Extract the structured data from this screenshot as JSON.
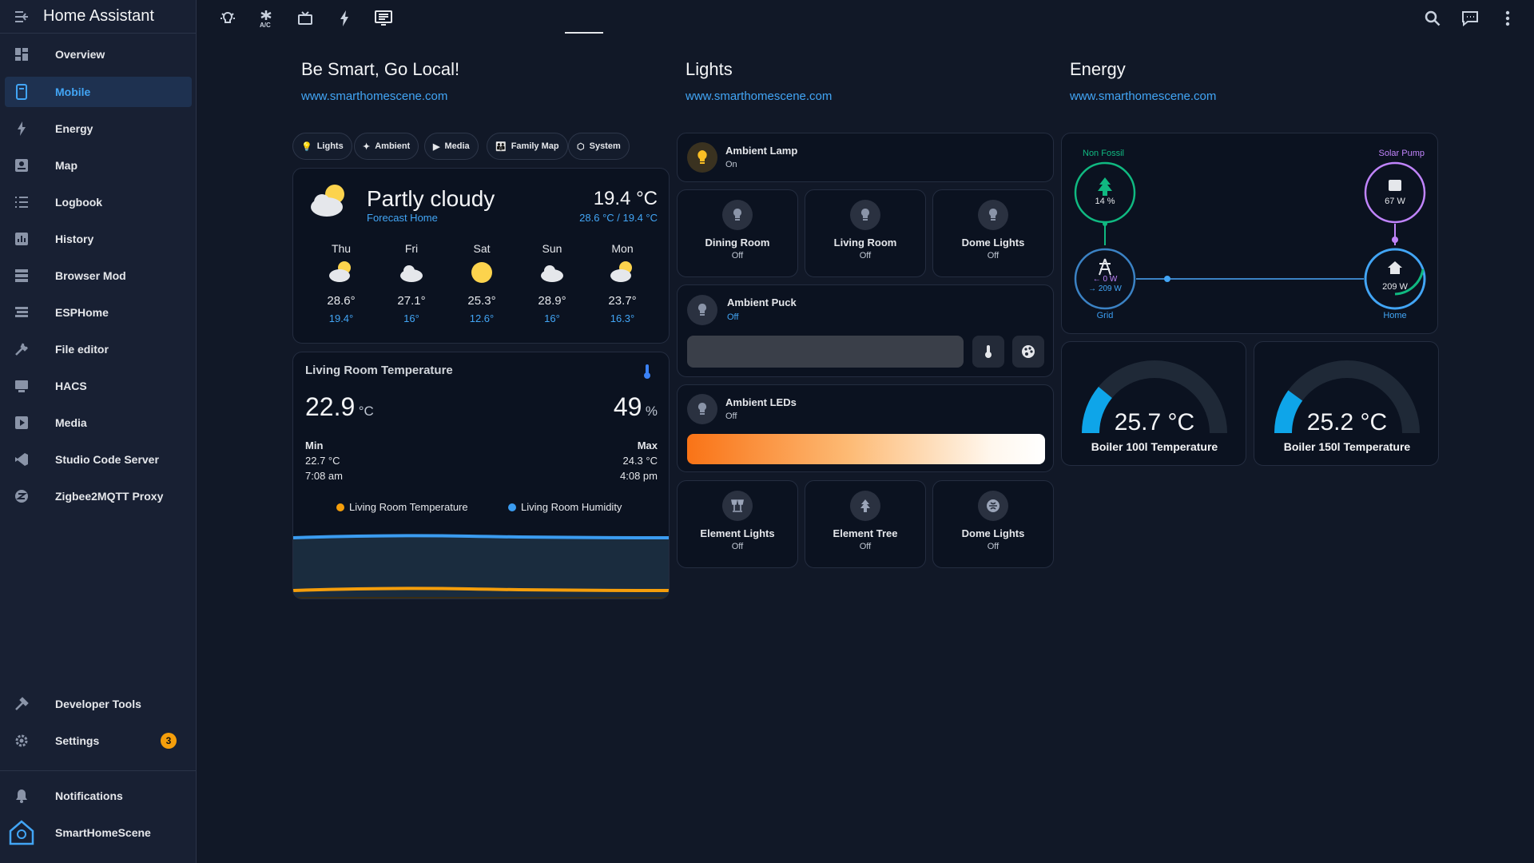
{
  "app": {
    "title": "Home Assistant"
  },
  "sidebar": {
    "items": [
      {
        "label": "Overview",
        "icon": "overview-icon"
      },
      {
        "label": "Mobile",
        "icon": "mobile-icon"
      },
      {
        "label": "Energy",
        "icon": "energy-icon"
      },
      {
        "label": "Map",
        "icon": "map-icon"
      },
      {
        "label": "Logbook",
        "icon": "logbook-icon"
      },
      {
        "label": "History",
        "icon": "history-icon"
      },
      {
        "label": "Browser Mod",
        "icon": "browser-mod-icon"
      },
      {
        "label": "ESPHome",
        "icon": "esphome-icon"
      },
      {
        "label": "File editor",
        "icon": "wrench-icon"
      },
      {
        "label": "HACS",
        "icon": "hacs-icon"
      },
      {
        "label": "Media",
        "icon": "media-icon"
      },
      {
        "label": "Studio Code Server",
        "icon": "vscode-icon"
      },
      {
        "label": "Zigbee2MQTT Proxy",
        "icon": "zigbee-icon"
      }
    ],
    "developer_tools": "Developer Tools",
    "settings": "Settings",
    "settings_badge": "3",
    "notifications": "Notifications",
    "user": "SmartHomeScene"
  },
  "columns": {
    "left": {
      "title": "Be Smart, Go Local!",
      "link": "www.smarthomescene.com"
    },
    "middle": {
      "title": "Lights",
      "link": "www.smarthomescene.com"
    },
    "right": {
      "title": "Energy",
      "link": "www.smarthomescene.com"
    }
  },
  "chips": [
    "Lights",
    "Ambient",
    "Media",
    "Family Map",
    "System"
  ],
  "weather": {
    "condition": "Partly cloudy",
    "source": "Forecast Home",
    "temp": "19.4 °C",
    "range": "28.6 °C / 19.4 °C",
    "days": [
      {
        "name": "Thu",
        "icon": "partly-cloudy-icon",
        "hi": "28.6°",
        "lo": "19.4°"
      },
      {
        "name": "Fri",
        "icon": "cloudy-icon",
        "hi": "27.1°",
        "lo": "16°"
      },
      {
        "name": "Sat",
        "icon": "sunny-icon",
        "hi": "25.3°",
        "lo": "12.6°"
      },
      {
        "name": "Sun",
        "icon": "cloudy-icon",
        "hi": "28.9°",
        "lo": "16°"
      },
      {
        "name": "Mon",
        "icon": "partly-cloudy-icon",
        "hi": "23.7°",
        "lo": "16.3°"
      }
    ]
  },
  "sensor": {
    "title": "Living Room Temperature",
    "temp": "22.9",
    "temp_unit": "°C",
    "humidity": "49",
    "humidity_unit": "%",
    "min_label": "Min",
    "min_value": "22.7 °C",
    "min_time": "7:08 am",
    "max_label": "Max",
    "max_value": "24.3 °C",
    "max_time": "4:08 pm",
    "legend_temp": "Living Room Temperature",
    "legend_humidity": "Living Room Humidity",
    "colors": {
      "temp": "#f59e0b",
      "humidity": "#3b9cf0"
    }
  },
  "lights": {
    "ambient_lamp": {
      "name": "Ambient Lamp",
      "state": "On"
    },
    "row1": [
      {
        "name": "Dining Room",
        "state": "Off"
      },
      {
        "name": "Living Room",
        "state": "Off"
      },
      {
        "name": "Dome Lights",
        "state": "Off"
      }
    ],
    "ambient_puck": {
      "name": "Ambient Puck",
      "state": "Off"
    },
    "ambient_leds": {
      "name": "Ambient LEDs",
      "state": "Off"
    },
    "row2": [
      {
        "name": "Element Lights",
        "state": "Off",
        "icon": "lamp-icon"
      },
      {
        "name": "Element Tree",
        "state": "Off",
        "icon": "tree-icon"
      },
      {
        "name": "Dome Lights",
        "state": "Off",
        "icon": "dome-icon"
      }
    ]
  },
  "energy": {
    "non_fossil_label": "Non Fossil",
    "non_fossil_value": "14 %",
    "solar_label": "Solar Pump",
    "solar_value": "67 W",
    "grid_label": "Grid",
    "grid_in": "← 0 W",
    "grid_out": "→ 209 W",
    "home_label": "Home",
    "home_value": "209 W",
    "colors": {
      "non_fossil": "#10b981",
      "solar": "#c084fc",
      "grid": "#3b82c4",
      "home": "#42a5f5"
    }
  },
  "gauges": [
    {
      "value": "25.7 °C",
      "name": "Boiler 100l Temperature",
      "fraction": 0.22
    },
    {
      "value": "25.2 °C",
      "name": "Boiler 150l Temperature",
      "fraction": 0.2
    }
  ]
}
